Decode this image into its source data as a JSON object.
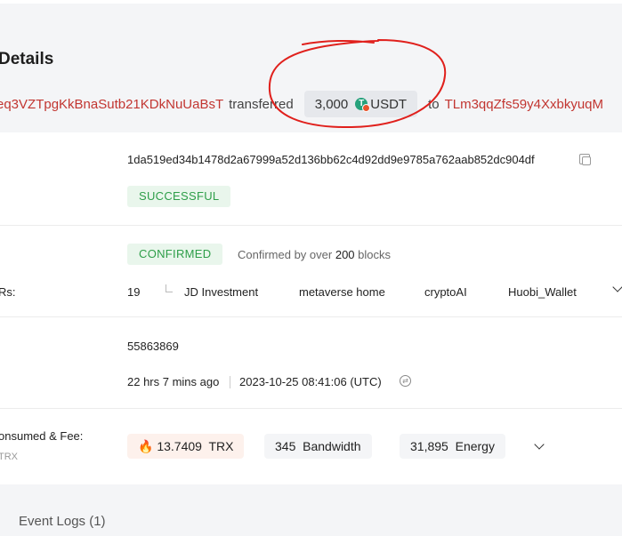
{
  "header": {
    "title": "Details",
    "from_address": "eq3VZTpgKkBnaSutb21KDkNuUaBsT",
    "transferred_word": "transferred",
    "amount": "3,000",
    "token": "USDT",
    "to_word": "to",
    "to_address": "TLm3qqZfs59y4XxbkyuqM"
  },
  "hash_row": {
    "hash": "1da519ed34b1478d2a67999a52d136bb62c4d92dd9e9785a762aab852dc904df",
    "status": "SUCCESSFUL"
  },
  "confirm_row": {
    "status": "CONFIRMED",
    "confirmed_prefix": "Confirmed by over",
    "blocks_count": "200",
    "blocks_suffix": "blocks",
    "label": "Rs:",
    "count": "19",
    "sr_names": [
      "JD Investment",
      "metaverse home",
      "cryptoAI",
      "Huobi_Wallet"
    ]
  },
  "block_row": {
    "block": "55863869",
    "age": "22 hrs 7 mins ago",
    "timestamp": "2023-10-25 08:41:06 (UTC)"
  },
  "fee_row": {
    "label": "onsumed & Fee:",
    "sublabel": "TRX",
    "trx_value": "13.7409",
    "trx_unit": "TRX",
    "bandwidth_value": "345",
    "bandwidth_unit": "Bandwidth",
    "energy_value": "31,895",
    "energy_unit": "Energy"
  },
  "event_logs": {
    "label": "Event Logs (1)"
  },
  "colors": {
    "address": "#c23631",
    "success": "#2e9e49",
    "usdt": "#26a17b",
    "annotation": "#e0201c"
  }
}
